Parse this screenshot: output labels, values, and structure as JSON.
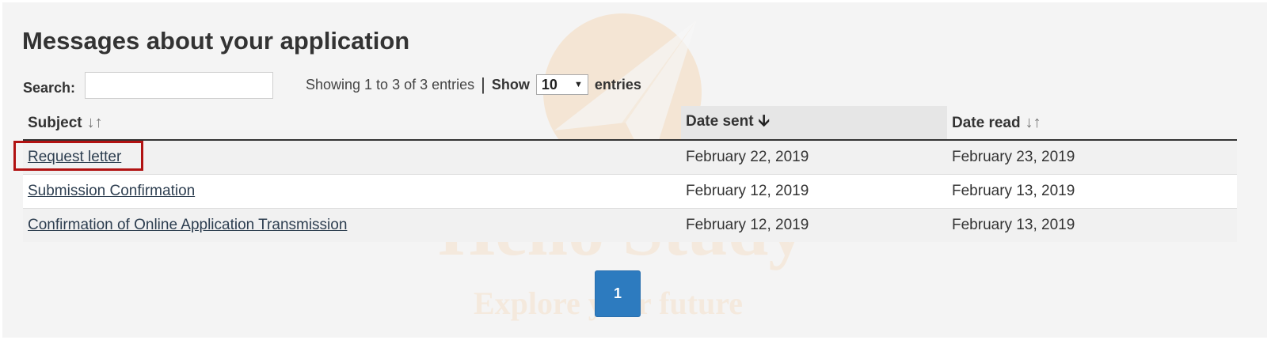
{
  "page": {
    "title": "Messages about your application"
  },
  "toolbar": {
    "search_label": "Search:",
    "search_value": "",
    "showing_text": "Showing 1 to 3 of 3 entries",
    "separator": "|",
    "show_label": "Show",
    "page_size": "10",
    "entries_label": "entries"
  },
  "table": {
    "columns": [
      {
        "label": "Subject",
        "sort_icon": "sort-both-icon"
      },
      {
        "label": "Date sent",
        "sort_icon": "sort-desc-icon"
      },
      {
        "label": "Date read",
        "sort_icon": "sort-both-icon"
      }
    ],
    "rows": [
      {
        "subject": "Request letter",
        "date_sent": "February 22, 2019",
        "date_read": "February 23, 2019"
      },
      {
        "subject": "Submission Confirmation",
        "date_sent": "February 12, 2019",
        "date_read": "February 13, 2019"
      },
      {
        "subject": "Confirmation of Online Application Transmission",
        "date_sent": "February 12, 2019",
        "date_read": "February 13, 2019"
      }
    ]
  },
  "pagination": {
    "current_page": "1"
  },
  "watermark": {
    "brand": "Hello Study",
    "tagline": "Explore your future",
    "color": "#f5a54a"
  },
  "colors": {
    "link": "#2d3e50",
    "highlight": "#b11212",
    "pager": "#2d7bbf"
  }
}
